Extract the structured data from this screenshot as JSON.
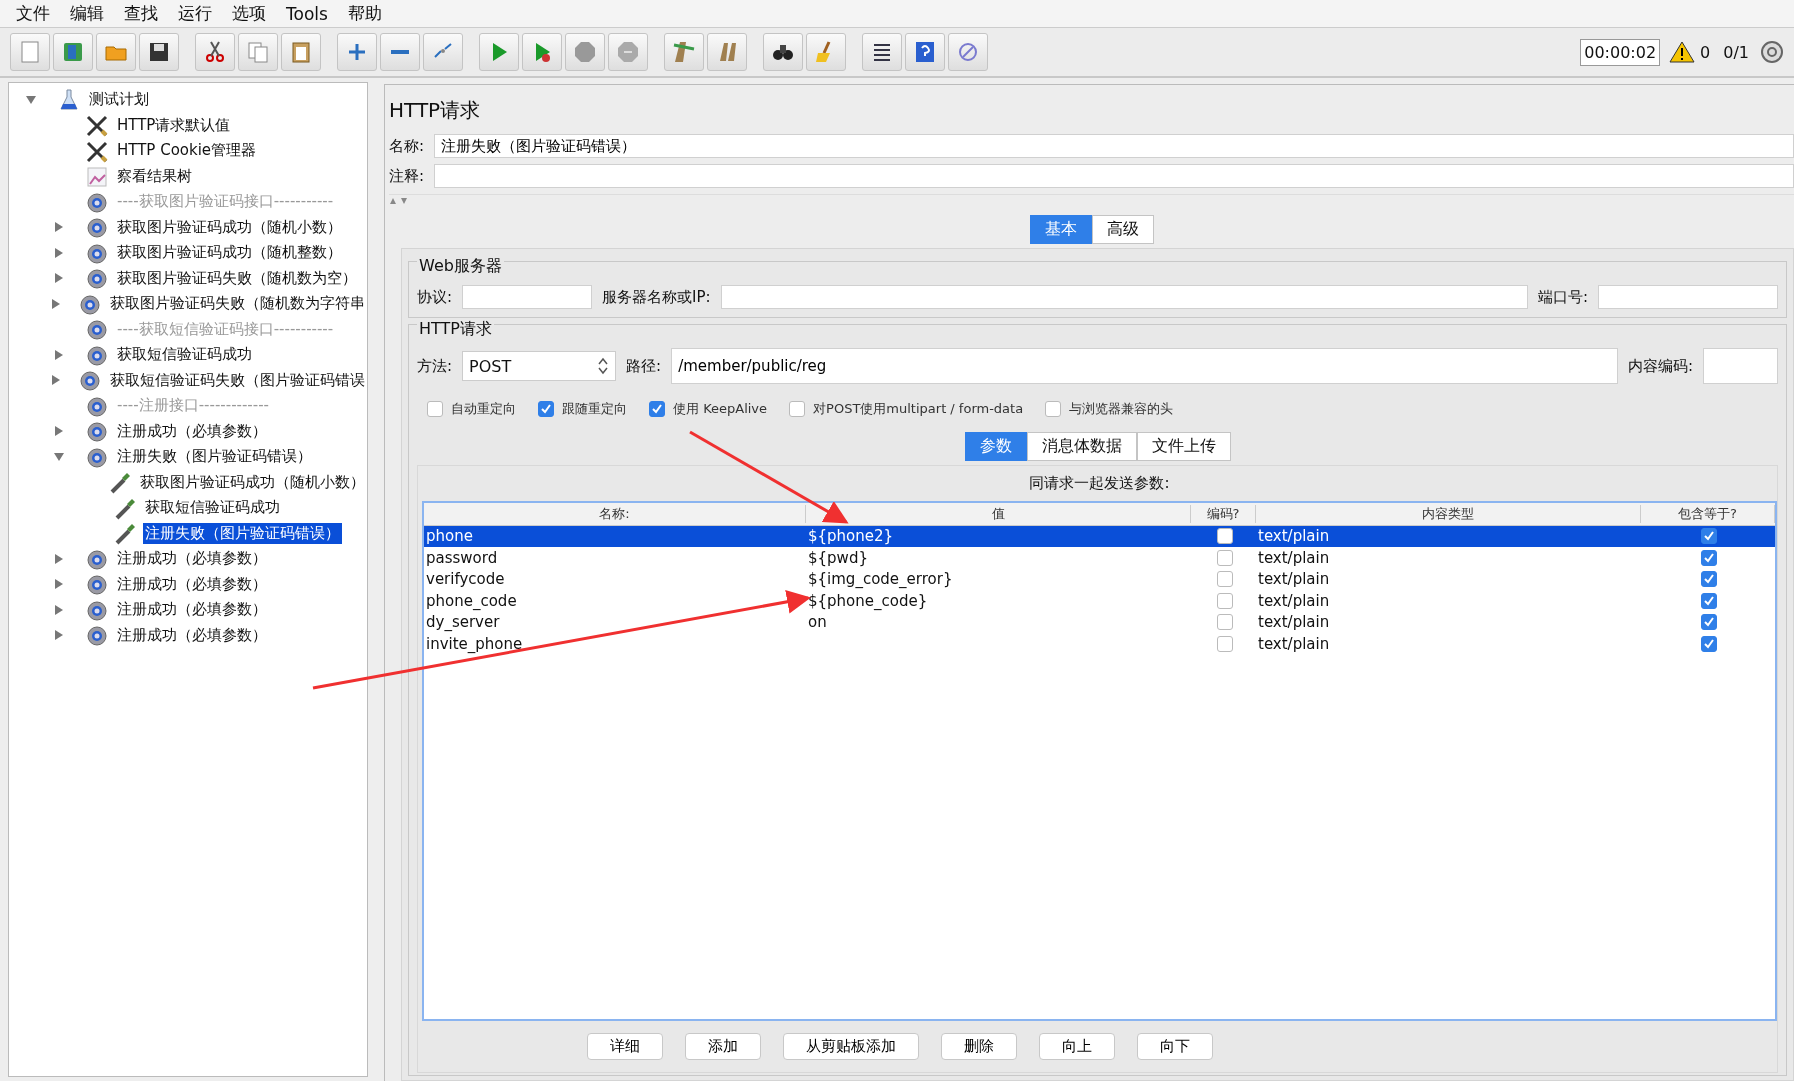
{
  "menu": [
    "文件",
    "编辑",
    "查找",
    "运行",
    "选项",
    "Tools",
    "帮助"
  ],
  "status": {
    "timer": "00:00:02",
    "warnings": "0",
    "threads": "0/1"
  },
  "tree": [
    {
      "label": "测试计划",
      "kind": "plan",
      "expanded": true,
      "disabled": false,
      "selected": false,
      "children": [
        {
          "label": "HTTP请求默认值",
          "kind": "config",
          "disabled": false,
          "selected": false
        },
        {
          "label": "HTTP Cookie管理器",
          "kind": "config",
          "disabled": false,
          "selected": false
        },
        {
          "label": "察看结果树",
          "kind": "listener",
          "disabled": false,
          "selected": false
        },
        {
          "label": "----获取图片验证码接口-----------",
          "kind": "thread",
          "disabled": true,
          "selected": false
        },
        {
          "label": "获取图片验证码成功（随机小数）",
          "kind": "thread",
          "expanded": false,
          "disabled": false,
          "selected": false
        },
        {
          "label": "获取图片验证码成功（随机整数）",
          "kind": "thread",
          "expanded": false,
          "disabled": false,
          "selected": false
        },
        {
          "label": "获取图片验证码失败（随机数为空）",
          "kind": "thread",
          "expanded": false,
          "disabled": false,
          "selected": false
        },
        {
          "label": "获取图片验证码失败（随机数为字符串",
          "kind": "thread",
          "expanded": false,
          "disabled": false,
          "selected": false
        },
        {
          "label": "----获取短信验证码接口-----------",
          "kind": "thread",
          "disabled": true,
          "selected": false
        },
        {
          "label": "获取短信验证码成功",
          "kind": "thread",
          "expanded": false,
          "disabled": false,
          "selected": false
        },
        {
          "label": "获取短信验证码失败（图片验证码错误",
          "kind": "thread",
          "expanded": false,
          "disabled": false,
          "selected": false
        },
        {
          "label": "----注册接口-------------",
          "kind": "thread",
          "disabled": true,
          "selected": false
        },
        {
          "label": "注册成功（必填参数）",
          "kind": "thread",
          "expanded": false,
          "disabled": false,
          "selected": false
        },
        {
          "label": "注册失败（图片验证码错误）",
          "kind": "thread",
          "expanded": true,
          "disabled": false,
          "selected": false,
          "children": [
            {
              "label": "获取图片验证码成功（随机小数）",
              "kind": "sampler",
              "disabled": false,
              "selected": false
            },
            {
              "label": "获取短信验证码成功",
              "kind": "sampler",
              "disabled": false,
              "selected": false
            },
            {
              "label": "注册失败（图片验证码错误）",
              "kind": "sampler",
              "disabled": false,
              "selected": true
            }
          ]
        },
        {
          "label": "注册成功（必填参数）",
          "kind": "thread",
          "expanded": false,
          "disabled": false,
          "selected": false
        },
        {
          "label": "注册成功（必填参数）",
          "kind": "thread",
          "expanded": false,
          "disabled": false,
          "selected": false
        },
        {
          "label": "注册成功（必填参数）",
          "kind": "thread",
          "expanded": false,
          "disabled": false,
          "selected": false
        },
        {
          "label": "注册成功（必填参数）",
          "kind": "thread",
          "expanded": false,
          "disabled": false,
          "selected": false
        }
      ]
    }
  ],
  "panel": {
    "title": "HTTP请求",
    "name_label": "名称:",
    "name_value": "注册失败（图片验证码错误）",
    "comment_label": "注释:",
    "tabs": [
      {
        "label": "基本",
        "selected": true
      },
      {
        "label": "高级",
        "selected": false
      }
    ],
    "web_server": {
      "title": "Web服务器",
      "protocol_label": "协议:",
      "server_label": "服务器名称或IP:",
      "port_label": "端口号:"
    },
    "http_request": {
      "title": "HTTP请求",
      "method_label": "方法:",
      "method": "POST",
      "path_label": "路径:",
      "path": "/member/public/reg",
      "encoding_label": "内容编码:",
      "options": [
        {
          "label": "自动重定向",
          "checked": false
        },
        {
          "label": "跟随重定向",
          "checked": true
        },
        {
          "label": "使用 KeepAlive",
          "checked": true
        },
        {
          "label": "对POST使用multipart / form-data",
          "checked": false
        },
        {
          "label": "与浏览器兼容的头",
          "checked": false
        }
      ]
    },
    "sub_tabs": [
      {
        "label": "参数",
        "selected": true
      },
      {
        "label": "消息体数据",
        "selected": false
      },
      {
        "label": "文件上传",
        "selected": false
      }
    ],
    "params_title": "同请求一起发送参数:",
    "columns": [
      "名称:",
      "值",
      "编码?",
      "内容类型",
      "包含等于?"
    ],
    "rows": [
      {
        "name": "phone",
        "value": "${phone2}",
        "encode": false,
        "content_type": "text/plain",
        "include_equals": true,
        "selected": true
      },
      {
        "name": "password",
        "value": "${pwd}",
        "encode": false,
        "content_type": "text/plain",
        "include_equals": true,
        "selected": false
      },
      {
        "name": "verifycode",
        "value": "${img_code_error}",
        "encode": false,
        "content_type": "text/plain",
        "include_equals": true,
        "selected": false
      },
      {
        "name": "phone_code",
        "value": "${phone_code}",
        "encode": false,
        "content_type": "text/plain",
        "include_equals": true,
        "selected": false
      },
      {
        "name": "dy_server",
        "value": "on",
        "encode": false,
        "content_type": "text/plain",
        "include_equals": true,
        "selected": false
      },
      {
        "name": "invite_phone",
        "value": "",
        "encode": false,
        "content_type": "text/plain",
        "include_equals": true,
        "selected": false
      }
    ],
    "buttons": [
      "详细",
      "添加",
      "从剪贴板添加",
      "删除",
      "向上",
      "向下"
    ]
  }
}
